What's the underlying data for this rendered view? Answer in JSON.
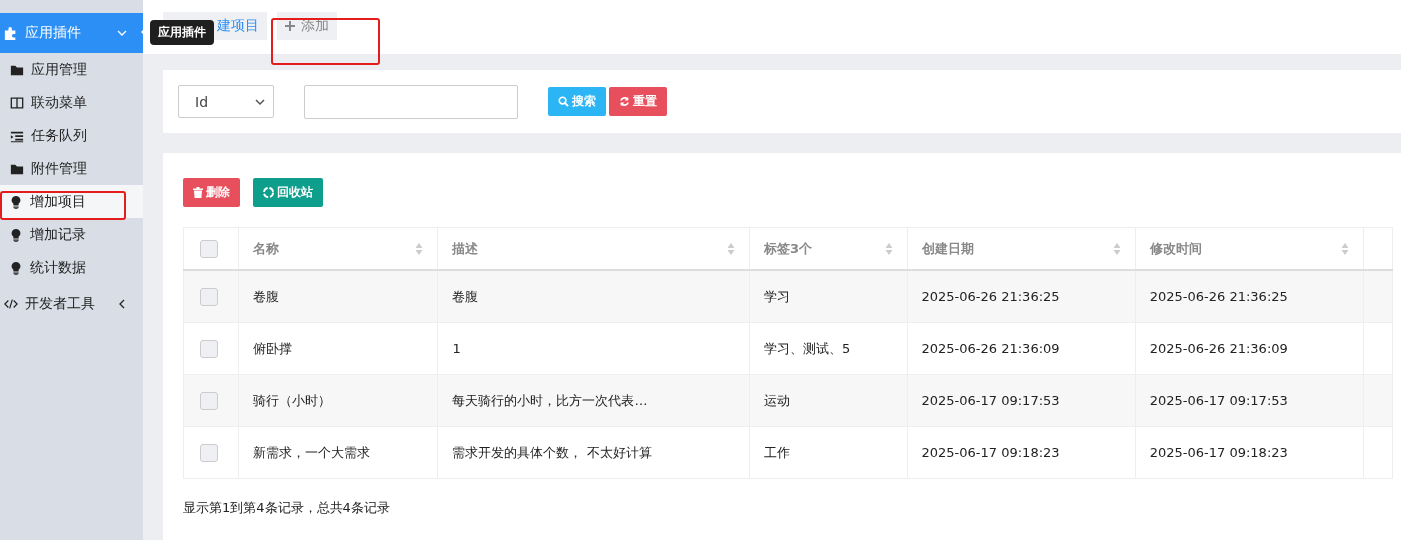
{
  "sidebar": {
    "menu": [
      {
        "kind": "group",
        "label": "应用插件",
        "expanded": true,
        "selected": true,
        "children": [
          {
            "label": "应用管理",
            "selected": false
          },
          {
            "label": "联动菜单",
            "selected": false
          },
          {
            "label": "任务队列",
            "selected": false
          },
          {
            "label": "附件管理",
            "selected": false
          }
        ]
      },
      {
        "kind": "item",
        "label": "增加项目",
        "selected": true
      },
      {
        "kind": "item",
        "label": "增加记录",
        "selected": false
      },
      {
        "kind": "item",
        "label": "统计数据",
        "selected": false
      },
      {
        "kind": "group",
        "label": "开发者工具",
        "expanded": false,
        "selected": false
      }
    ]
  },
  "tooltip": "应用插件",
  "tabs": [
    {
      "label": "建项目",
      "kind": "plain",
      "selected": true
    },
    {
      "label": "添加",
      "kind": "add",
      "selected": false
    }
  ],
  "search": {
    "field_select": "Id",
    "buttons": [
      {
        "kind": "search",
        "label": "搜索"
      },
      {
        "kind": "reset",
        "label": "重置"
      }
    ]
  },
  "toolbar": [
    {
      "kind": "delete",
      "label": "删除"
    },
    {
      "kind": "recycle",
      "label": "回收站"
    }
  ],
  "table": {
    "select_all_checked": false,
    "columns": [
      "名称",
      "描述",
      "标签3个",
      "创建日期",
      "修改时间"
    ],
    "rows": [
      {
        "checked": false,
        "cells": [
          "卷腹",
          "卷腹",
          "学习",
          "2025-06-26 21:36:25",
          "2025-06-26 21:36:25"
        ]
      },
      {
        "checked": false,
        "cells": [
          "俯卧撑",
          "1",
          "学习、测试、5",
          "2025-06-26 21:36:09",
          "2025-06-26 21:36:09"
        ]
      },
      {
        "checked": false,
        "cells": [
          "骑行（小时）",
          "每天骑行的小时，比方一次代表…",
          "运动",
          "2025-06-17 09:17:53",
          "2025-06-17 09:17:53"
        ]
      },
      {
        "checked": false,
        "cells": [
          "新需求，一个大需求",
          "需求开发的具体个数， 不太好计算",
          "工作",
          "2025-06-17 09:18:23",
          "2025-06-17 09:18:23"
        ]
      }
    ]
  },
  "pagination_info": "显示第1到第4条记录，总共4条记录"
}
